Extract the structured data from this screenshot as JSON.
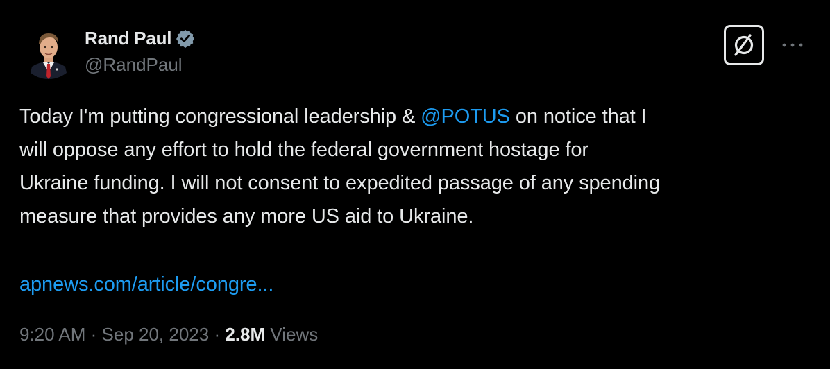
{
  "author": {
    "display_name": "Rand Paul",
    "handle": "@RandPaul",
    "verified": true
  },
  "tweet": {
    "text_before_mention": "Today I'm putting congressional leadership & ",
    "mention": "@POTUS",
    "text_after_mention": " on notice that I\nwill oppose any effort to hold the federal government hostage for\nUkraine funding. I will not consent to expedited passage of any spending\nmeasure that provides any more US aid to Ukraine.",
    "link": "apnews.com/article/congre..."
  },
  "meta": {
    "time": "9:20 AM",
    "separator": " · ",
    "date": "Sep 20, 2023",
    "views_count": "2.8M",
    "views_label": " Views"
  },
  "icons": {
    "verified": "verified-badge-icon",
    "grok": "grok-icon",
    "more": "more-icon"
  },
  "colors": {
    "background": "#000000",
    "text": "#e7e9ea",
    "secondary": "#71767b",
    "accent": "#1d9bf0"
  }
}
